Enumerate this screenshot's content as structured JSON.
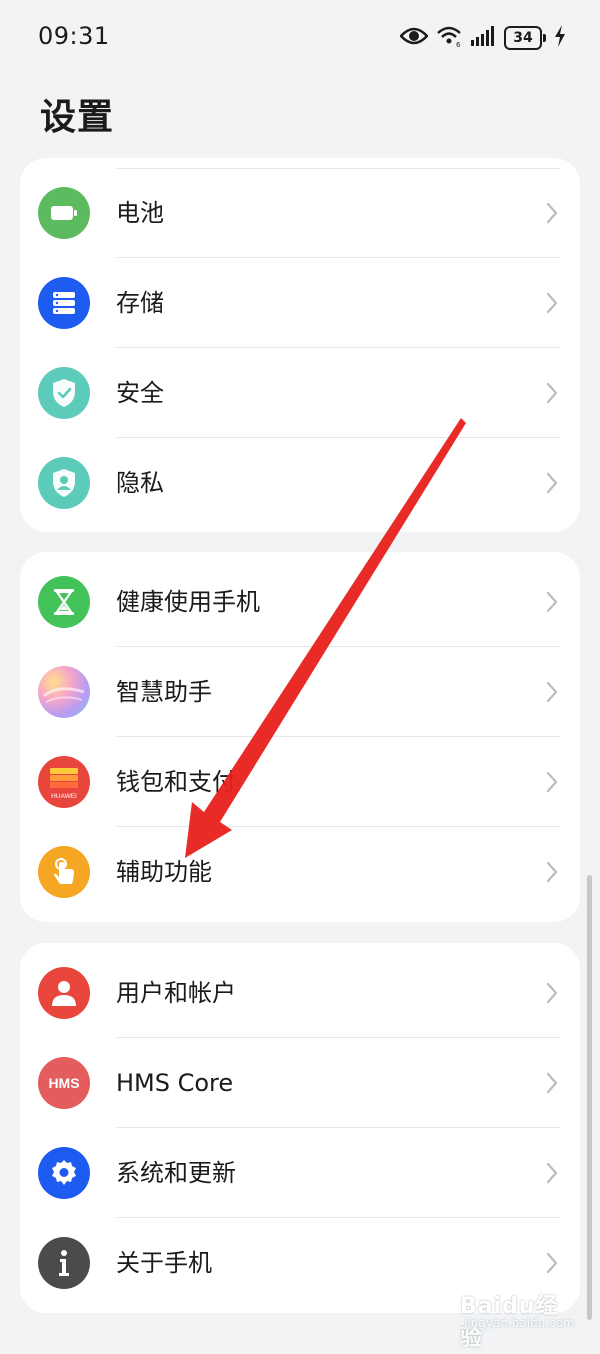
{
  "status_bar": {
    "time": "09:31",
    "battery_level": "34",
    "icons": [
      "eye-icon",
      "wifi-icon",
      "signal-icon",
      "battery-icon",
      "charging-icon"
    ]
  },
  "page": {
    "title": "设置"
  },
  "groups": [
    {
      "items": [
        {
          "label": "电池",
          "icon": "battery-icon",
          "color": "#5cbb5f"
        },
        {
          "label": "存储",
          "icon": "storage-icon",
          "color": "#1e5bf0"
        },
        {
          "label": "安全",
          "icon": "security-shield-icon",
          "color": "#5ccbb9"
        },
        {
          "label": "隐私",
          "icon": "privacy-shield-icon",
          "color": "#5ccbb9"
        }
      ]
    },
    {
      "items": [
        {
          "label": "健康使用手机",
          "icon": "hourglass-icon",
          "color": "#43c25a"
        },
        {
          "label": "智慧助手",
          "icon": "assistant-orb-icon",
          "color": "#c9a8ee"
        },
        {
          "label": "钱包和支付",
          "icon": "wallet-icon",
          "color": "#e8453c",
          "brand": "HUAWEI"
        },
        {
          "label": "辅助功能",
          "icon": "hand-touch-icon",
          "color": "#f5a623"
        }
      ]
    },
    {
      "items": [
        {
          "label": "用户和帐户",
          "icon": "user-icon",
          "color": "#e8453c"
        },
        {
          "label": "HMS Core",
          "icon": "hms-icon",
          "color": "#e35d5d",
          "brand": "HMS"
        },
        {
          "label": "系统和更新",
          "icon": "gear-icon",
          "color": "#1e5bf0"
        },
        {
          "label": "关于手机",
          "icon": "info-icon",
          "color": "#4b4b4b"
        }
      ]
    }
  ],
  "annotation": {
    "type": "arrow",
    "color": "#e8201c"
  },
  "watermark": {
    "text": "Baidu经验",
    "sub": "jingyan.baidu.com"
  }
}
